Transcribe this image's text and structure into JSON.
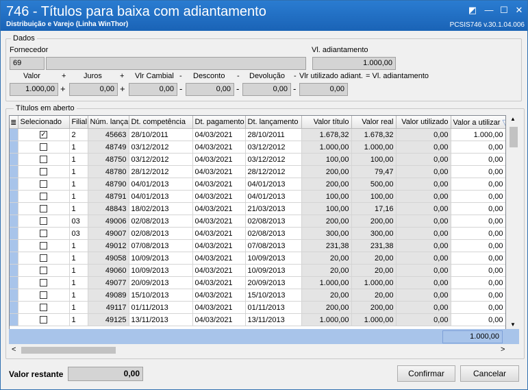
{
  "window": {
    "title": "746 - Títulos para baixa com adiantamento",
    "subtitle": "Distribuição e Varejo (Linha WinThor)",
    "version": "PCSIS746  v.30.1.04.006",
    "restore_icon": "◩",
    "minimize_icon": "—",
    "maximize_icon": "☐",
    "close_icon": "✕"
  },
  "dados": {
    "legend": "Dados",
    "fornecedor_label": "Fornecedor",
    "fornecedor_code": "69",
    "fornecedor_name": "",
    "vl_adiantamento_label": "Vl. adiantamento",
    "vl_adiantamento": "1.000,00",
    "valor_label": "Valor",
    "valor": "1.000,00",
    "juros_label": "Juros",
    "juros": "0,00",
    "cambial_label": "Vlr Cambial",
    "cambial": "0,00",
    "desconto_label": "Desconto",
    "desconto": "0,00",
    "devolucao_label": "Devolução",
    "devolucao": "0,00",
    "utilizado_label": "Vlr utilizado adiant.",
    "utilizado": "0,00",
    "eq_label": "= Vl. adiantamento",
    "op_plus": "+",
    "op_minus": "-"
  },
  "titulos": {
    "legend": "Títulos em aberto",
    "menu_icon": "≣",
    "sort_icon": "▽",
    "columns": [
      "Selecionado",
      "Filial",
      "Núm. lançamento",
      "Dt. competência",
      "Dt. pagamento",
      "Dt. lançamento",
      "Valor título",
      "Valor real",
      "Valor utilizado",
      "Valor a utilizar"
    ],
    "rows": [
      {
        "sel": true,
        "filial": "2",
        "num": "45663",
        "comp": "28/10/2011",
        "pag": "04/03/2021",
        "lanc": "28/10/2011",
        "titulo": "1.678,32",
        "real": "1.678,32",
        "utilizado": "0,00",
        "utilizar": "1.000,00"
      },
      {
        "sel": false,
        "filial": "1",
        "num": "48749",
        "comp": "03/12/2012",
        "pag": "04/03/2021",
        "lanc": "03/12/2012",
        "titulo": "1.000,00",
        "real": "1.000,00",
        "utilizado": "0,00",
        "utilizar": "0,00"
      },
      {
        "sel": false,
        "filial": "1",
        "num": "48750",
        "comp": "03/12/2012",
        "pag": "04/03/2021",
        "lanc": "03/12/2012",
        "titulo": "100,00",
        "real": "100,00",
        "utilizado": "0,00",
        "utilizar": "0,00"
      },
      {
        "sel": false,
        "filial": "1",
        "num": "48780",
        "comp": "28/12/2012",
        "pag": "04/03/2021",
        "lanc": "28/12/2012",
        "titulo": "200,00",
        "real": "79,47",
        "utilizado": "0,00",
        "utilizar": "0,00"
      },
      {
        "sel": false,
        "filial": "1",
        "num": "48790",
        "comp": "04/01/2013",
        "pag": "04/03/2021",
        "lanc": "04/01/2013",
        "titulo": "200,00",
        "real": "500,00",
        "utilizado": "0,00",
        "utilizar": "0,00"
      },
      {
        "sel": false,
        "filial": "1",
        "num": "48791",
        "comp": "04/01/2013",
        "pag": "04/03/2021",
        "lanc": "04/01/2013",
        "titulo": "100,00",
        "real": "100,00",
        "utilizado": "0,00",
        "utilizar": "0,00"
      },
      {
        "sel": false,
        "filial": "1",
        "num": "48843",
        "comp": "18/02/2013",
        "pag": "04/03/2021",
        "lanc": "21/03/2013",
        "titulo": "100,00",
        "real": "17,16",
        "utilizado": "0,00",
        "utilizar": "0,00"
      },
      {
        "sel": false,
        "filial": "03",
        "num": "49006",
        "comp": "02/08/2013",
        "pag": "04/03/2021",
        "lanc": "02/08/2013",
        "titulo": "200,00",
        "real": "200,00",
        "utilizado": "0,00",
        "utilizar": "0,00"
      },
      {
        "sel": false,
        "filial": "03",
        "num": "49007",
        "comp": "02/08/2013",
        "pag": "04/03/2021",
        "lanc": "02/08/2013",
        "titulo": "300,00",
        "real": "300,00",
        "utilizado": "0,00",
        "utilizar": "0,00"
      },
      {
        "sel": false,
        "filial": "1",
        "num": "49012",
        "comp": "07/08/2013",
        "pag": "04/03/2021",
        "lanc": "07/08/2013",
        "titulo": "231,38",
        "real": "231,38",
        "utilizado": "0,00",
        "utilizar": "0,00"
      },
      {
        "sel": false,
        "filial": "1",
        "num": "49058",
        "comp": "10/09/2013",
        "pag": "04/03/2021",
        "lanc": "10/09/2013",
        "titulo": "20,00",
        "real": "20,00",
        "utilizado": "0,00",
        "utilizar": "0,00"
      },
      {
        "sel": false,
        "filial": "1",
        "num": "49060",
        "comp": "10/09/2013",
        "pag": "04/03/2021",
        "lanc": "10/09/2013",
        "titulo": "20,00",
        "real": "20,00",
        "utilizado": "0,00",
        "utilizar": "0,00"
      },
      {
        "sel": false,
        "filial": "1",
        "num": "49077",
        "comp": "20/09/2013",
        "pag": "04/03/2021",
        "lanc": "20/09/2013",
        "titulo": "1.000,00",
        "real": "1.000,00",
        "utilizado": "0,00",
        "utilizar": "0,00"
      },
      {
        "sel": false,
        "filial": "1",
        "num": "49089",
        "comp": "15/10/2013",
        "pag": "04/03/2021",
        "lanc": "15/10/2013",
        "titulo": "20,00",
        "real": "20,00",
        "utilizado": "0,00",
        "utilizar": "0,00"
      },
      {
        "sel": false,
        "filial": "1",
        "num": "49117",
        "comp": "01/11/2013",
        "pag": "04/03/2021",
        "lanc": "01/11/2013",
        "titulo": "200,00",
        "real": "200,00",
        "utilizado": "0,00",
        "utilizar": "0,00"
      },
      {
        "sel": false,
        "filial": "1",
        "num": "49125",
        "comp": "13/11/2013",
        "pag": "04/03/2021",
        "lanc": "13/11/2013",
        "titulo": "1.000,00",
        "real": "1.000,00",
        "utilizado": "0,00",
        "utilizar": "0,00"
      }
    ],
    "total_utilizar": "1.000,00",
    "scroll_up": "▲",
    "scroll_down": "▼",
    "scroll_left": "<",
    "scroll_right": ">"
  },
  "footer": {
    "valor_restante_label": "Valor restante",
    "valor_restante": "0,00",
    "confirmar_label": "Confirmar",
    "cancelar_label": "Cancelar"
  }
}
